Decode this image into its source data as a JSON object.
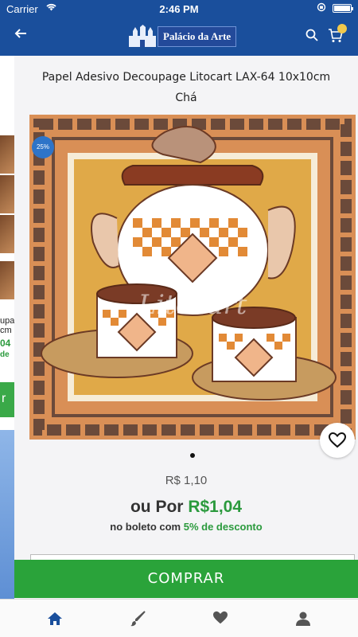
{
  "status_bar": {
    "carrier": "Carrier",
    "time": "2:46 PM"
  },
  "header": {
    "back_icon": "arrow-left-icon",
    "logo_text": "Palácio da Arte",
    "search_icon": "search-icon",
    "cart_icon": "cart-icon"
  },
  "peek": {
    "text_1": "upa",
    "text_2": "cm",
    "price_1": "04",
    "price_2": "de",
    "button": "r"
  },
  "product": {
    "title": "Papel Adesivo Decoupage Litocart LAX-64 10x10cm Chá",
    "discount_badge": "25%",
    "image_label": "Litocart",
    "old_price": "R$ 1,10",
    "price_prefix": "ou Por ",
    "price": "R$1,04",
    "boleto_prefix": "no boleto com ",
    "boleto_discount": "5% de desconto",
    "gallery_page": 1,
    "gallery_total": 1
  },
  "actions": {
    "buy_label": "COMPRAR"
  },
  "tabbar": {
    "items": [
      "home-icon",
      "brush-icon",
      "heart-icon",
      "user-icon"
    ],
    "active": "home-icon",
    "active_color": "#1a4f9c",
    "inactive_color": "#555555"
  },
  "colors": {
    "brand": "#1a4f9c",
    "accent_green": "#2aa33a"
  }
}
